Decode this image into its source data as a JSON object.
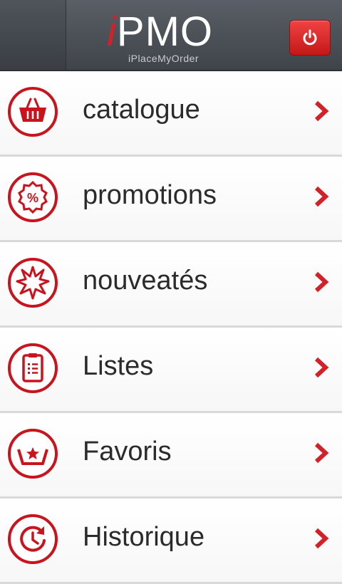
{
  "header": {
    "logo_i": "i",
    "logo_text": "PMO",
    "logo_subtitle": "iPlaceMyOrder",
    "power_icon": "power-icon"
  },
  "colors": {
    "accent": "#d3212a",
    "header_bg": "#4a4f56",
    "row_bg": "#ffffff",
    "text": "#2b2b2b"
  },
  "menu": {
    "items": [
      {
        "label": "catalogue",
        "icon": "basket-icon"
      },
      {
        "label": "promotions",
        "icon": "percent-badge-icon"
      },
      {
        "label": "nouveatés",
        "icon": "burst-icon"
      },
      {
        "label": "Listes",
        "icon": "clipboard-icon"
      },
      {
        "label": "Favoris",
        "icon": "star-basket-icon"
      },
      {
        "label": "Historique",
        "icon": "history-icon"
      }
    ]
  }
}
